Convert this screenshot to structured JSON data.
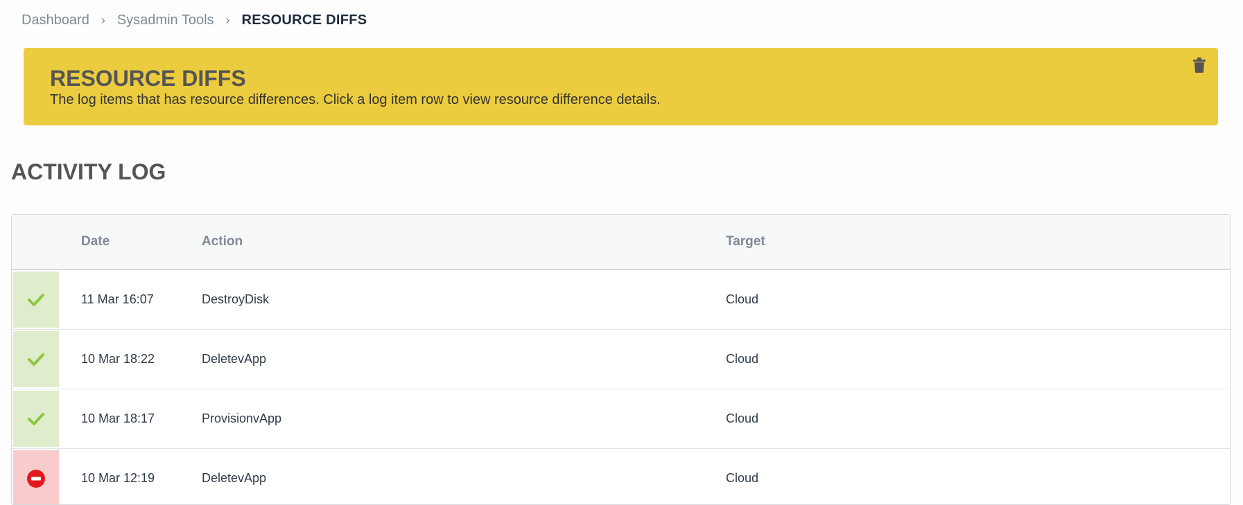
{
  "breadcrumb": {
    "items": [
      "Dashboard",
      "Sysadmin Tools"
    ],
    "current": "RESOURCE DIFFS"
  },
  "banner": {
    "title": "RESOURCE DIFFS",
    "description": "The log items that has resource differences. Click a log item row to view resource difference details.",
    "background": "#ebcc3e",
    "icon": "trash-icon"
  },
  "section": {
    "title": "ACTIVITY LOG"
  },
  "table": {
    "columns": [
      "",
      "Date",
      "Action",
      "Target"
    ],
    "rows": [
      {
        "status": "success",
        "date": "11 Mar 16:07",
        "action": "DestroyDisk",
        "target": "Cloud"
      },
      {
        "status": "success",
        "date": "10 Mar 18:22",
        "action": "DeletevApp",
        "target": "Cloud"
      },
      {
        "status": "success",
        "date": "10 Mar 18:17",
        "action": "ProvisionvApp",
        "target": "Cloud"
      },
      {
        "status": "error",
        "date": "10 Mar 12:19",
        "action": "DeletevApp",
        "target": "Cloud"
      }
    ]
  },
  "colors": {
    "success_bg": "#dfedcc",
    "success_icon": "#8dc63f",
    "error_bg": "#f8cccd",
    "error_icon": "#e3171d"
  }
}
